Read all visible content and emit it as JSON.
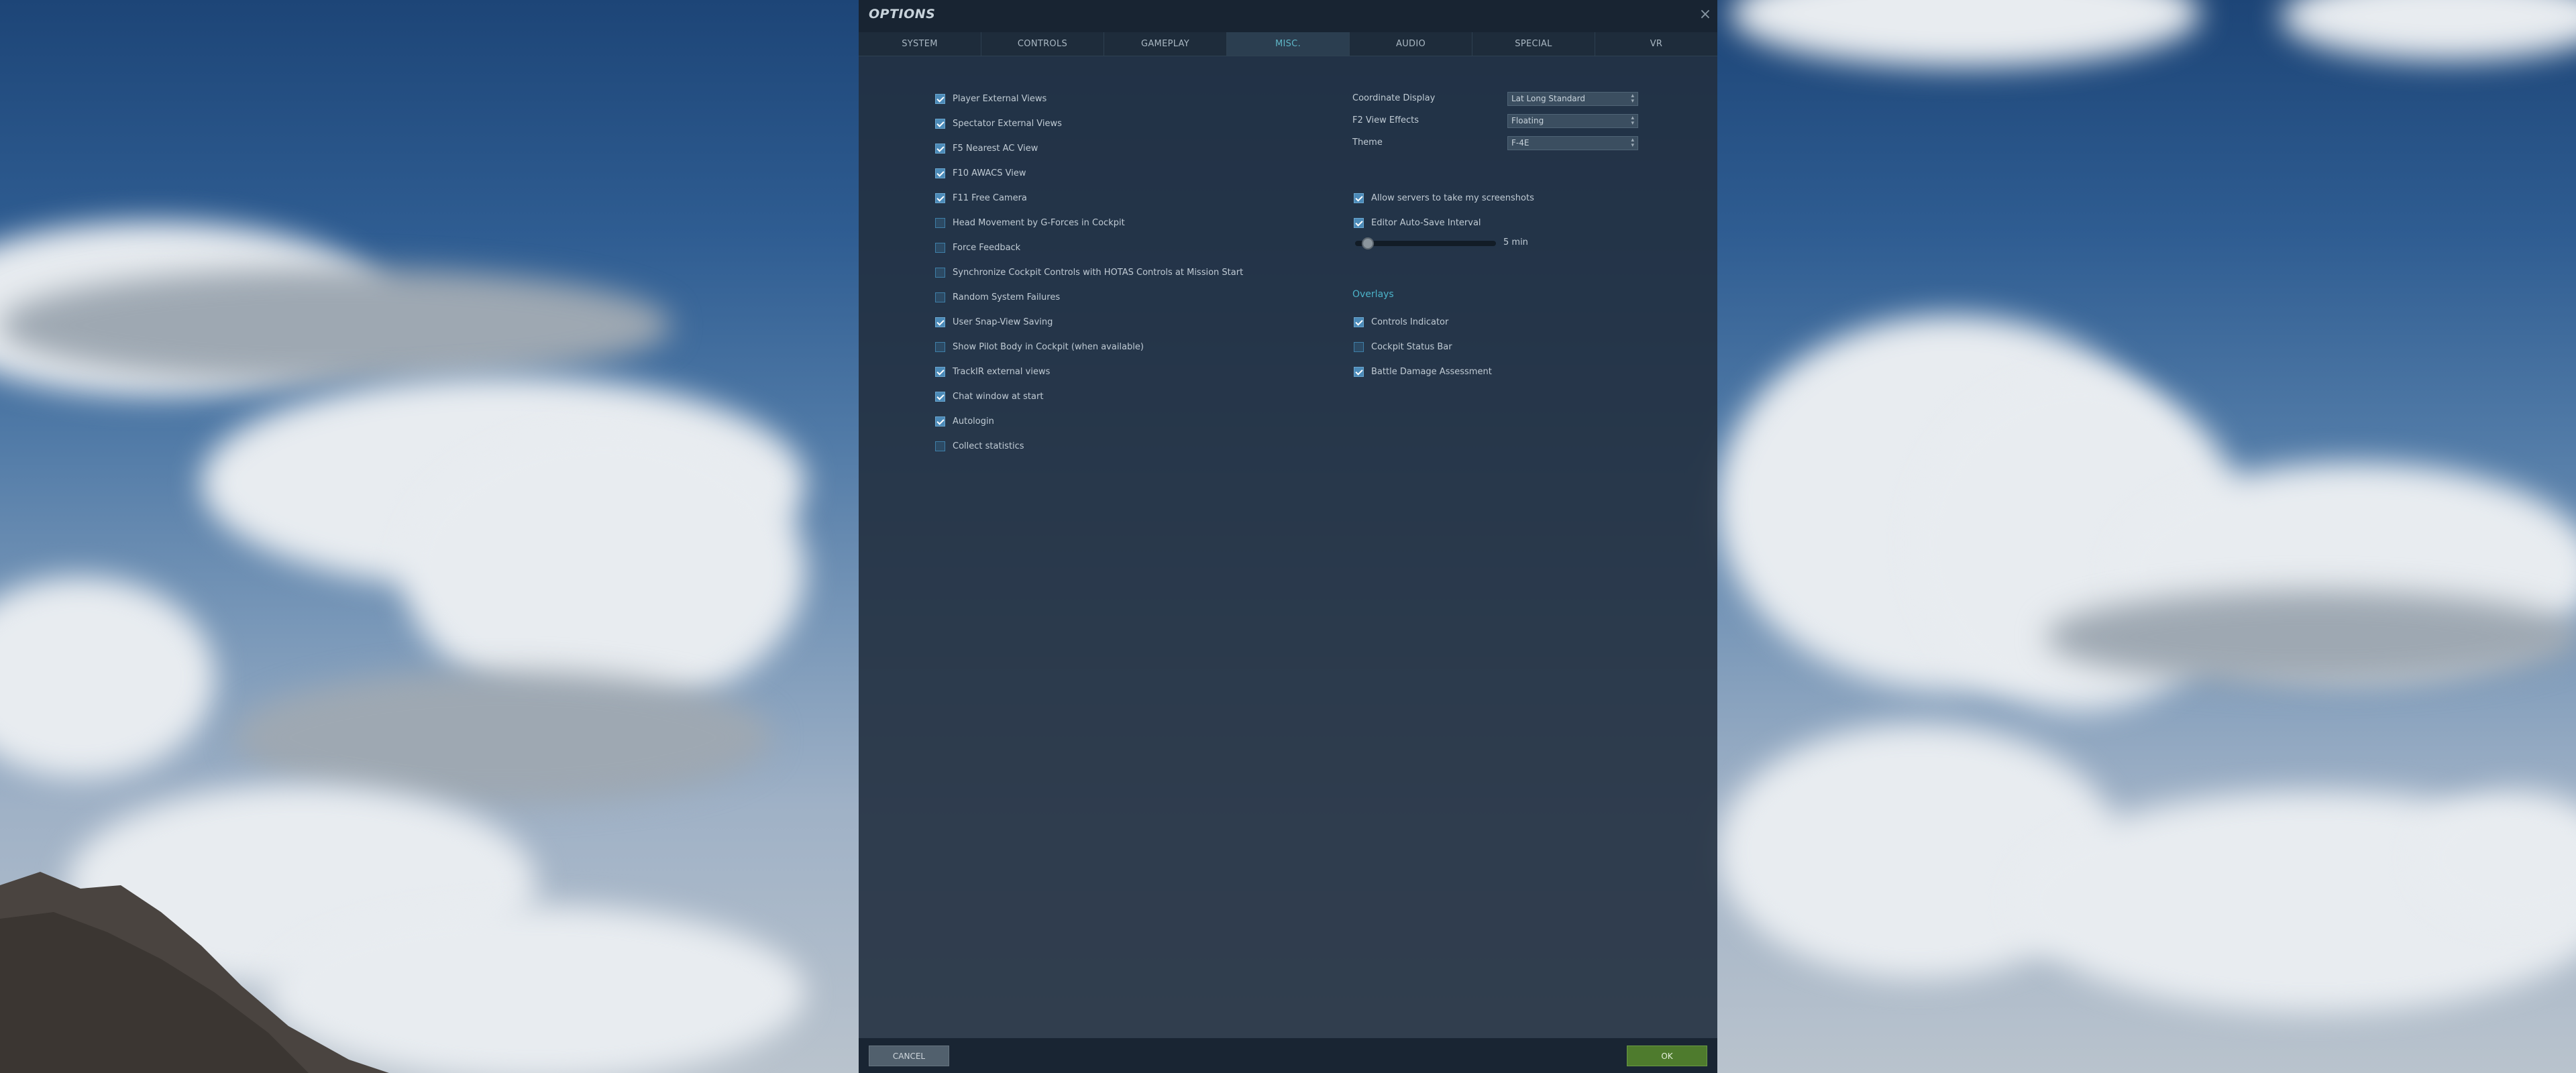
{
  "dialog": {
    "title": "OPTIONS",
    "close_glyph": "×"
  },
  "tabs": [
    {
      "label": "SYSTEM"
    },
    {
      "label": "CONTROLS"
    },
    {
      "label": "GAMEPLAY"
    },
    {
      "label": "MISC."
    },
    {
      "label": "AUDIO"
    },
    {
      "label": "SPECIAL"
    },
    {
      "label": "VR"
    }
  ],
  "active_tab": "MISC.",
  "left_checks": [
    {
      "label": "Player External Views",
      "checked": true
    },
    {
      "label": "Spectator External Views",
      "checked": true
    },
    {
      "label": "F5 Nearest AC View",
      "checked": true
    },
    {
      "label": "F10 AWACS View",
      "checked": true
    },
    {
      "label": "F11 Free Camera",
      "checked": true
    },
    {
      "label": "Head Movement by G-Forces in Cockpit",
      "checked": false
    },
    {
      "label": "Force Feedback",
      "checked": false
    },
    {
      "label": "Synchronize Cockpit Controls with HOTAS Controls at Mission Start",
      "checked": false
    },
    {
      "label": "Random System Failures",
      "checked": false
    },
    {
      "label": "User Snap-View Saving",
      "checked": true
    },
    {
      "label": "Show Pilot Body in Cockpit (when available)",
      "checked": false
    },
    {
      "label": "TrackIR external views",
      "checked": true
    },
    {
      "label": "Chat window at start",
      "checked": true
    },
    {
      "label": "Autologin",
      "checked": true
    },
    {
      "label": "Collect statistics",
      "checked": false
    }
  ],
  "right_selects": [
    {
      "label": "Coordinate Display",
      "value": "Lat Long Standard"
    },
    {
      "label": "F2 View Effects",
      "value": "Floating"
    },
    {
      "label": "Theme",
      "value": "F-4E"
    }
  ],
  "right_checks": [
    {
      "label": "Allow servers to take my screenshots",
      "checked": true
    },
    {
      "label": "Editor Auto-Save Interval",
      "checked": true
    }
  ],
  "autosave_slider": {
    "value_label": "5 min",
    "level": 0.05
  },
  "overlays": {
    "title": "Overlays",
    "items": [
      {
        "label": "Controls Indicator",
        "checked": true
      },
      {
        "label": "Cockpit Status Bar",
        "checked": false
      },
      {
        "label": "Battle Damage Assessment",
        "checked": true
      }
    ]
  },
  "footer": {
    "cancel_label": "CANCEL",
    "ok_label": "OK"
  },
  "colors": {
    "accent": "#5fb6c6",
    "ok_button": "#4e7b2d",
    "cancel_button": "#51606d",
    "checkbox": "#4b8ab8"
  }
}
